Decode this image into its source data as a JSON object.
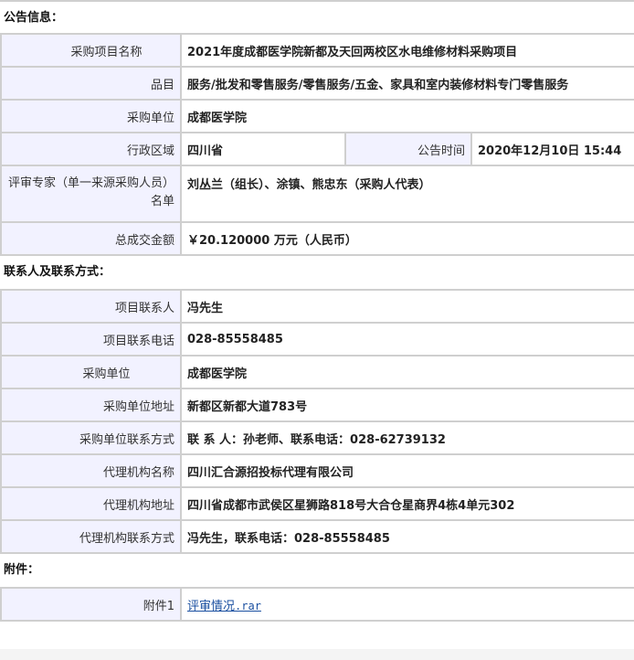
{
  "announcement": {
    "section_title": "公告信息：",
    "project_name_label": "采购项目名称",
    "project_name": "2021年度成都医学院新都及天回两校区水电维修材料采购项目",
    "category_label": "品目",
    "category": "服务/批发和零售服务/零售服务/五金、家具和室内装修材料专门零售服务",
    "purchaser_label": "采购单位",
    "purchaser": "成都医学院",
    "region_label": "行政区域",
    "region": "四川省",
    "announce_time_label": "公告时间",
    "announce_time": "2020年12月10日 15:44",
    "experts_label": "评审专家（单一来源采购人员）名单",
    "experts": "刘丛兰（组长）、涂镇、熊忠东（采购人代表）",
    "total_label": "总成交金额",
    "total": "￥20.120000 万元（人民币）"
  },
  "contacts": {
    "section_title": "联系人及联系方式：",
    "rows": [
      {
        "label": "项目联系人",
        "value": "冯先生"
      },
      {
        "label": "项目联系电话",
        "value": "028-85558485"
      },
      {
        "label": "采购单位",
        "value": "成都医学院"
      },
      {
        "label": "采购单位地址",
        "value": "新都区新都大道783号"
      },
      {
        "label": "采购单位联系方式",
        "value": "联 系 人：孙老师、联系电话：028-62739132"
      },
      {
        "label": "代理机构名称",
        "value": "四川汇合源招投标代理有限公司"
      },
      {
        "label": "代理机构地址",
        "value": "四川省成都市武侯区星狮路818号大合仓星商界4栋4单元302"
      },
      {
        "label": "代理机构联系方式",
        "value": "冯先生，联系电话：028-85558485"
      }
    ]
  },
  "attachments": {
    "section_title": "附件：",
    "label": "附件1",
    "file_name": "评审情况",
    "file_ext": ".rar"
  }
}
